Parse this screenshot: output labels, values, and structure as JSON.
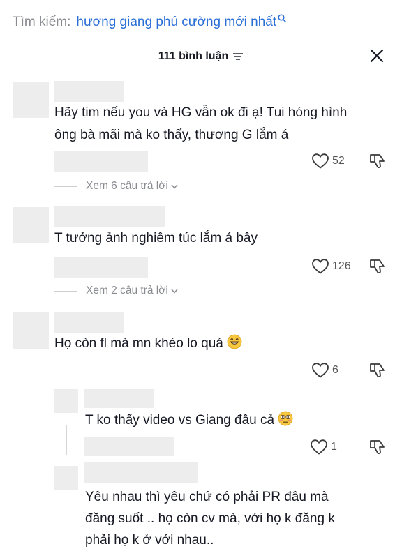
{
  "search": {
    "label": "Tìm kiếm:",
    "query": "hương giang phú cường mới nhất"
  },
  "sheet": {
    "comment_count": "111 bình luận"
  },
  "comments": [
    {
      "text_lines": [
        "Hãy tim nếu you và HG vẫn ok đi ạ! Tui hóng hình",
        "ông bà mãi mà ko thấy, thương G lắm á"
      ],
      "likes": "52",
      "replies": "Xem 6 câu trả lời"
    },
    {
      "text_lines": [
        "T tưởng ảnh nghiêm túc lắm á bây"
      ],
      "likes": "126",
      "replies": "Xem 2 câu trả lời"
    },
    {
      "text_lines": [
        "Họ còn fl mà mn khéo lo quá"
      ],
      "likes": "6",
      "emoji": "grinning-face-emoji"
    }
  ],
  "replies": [
    {
      "text_lines": [
        "T ko thấy video vs Giang đâu cả"
      ],
      "likes": "1",
      "emoji": "flushed-face-emoji"
    },
    {
      "text_lines": [
        "Yêu nhau thì yêu chứ có phải PR đâu mà",
        "đăng suốt .. họ còn cv mà, với họ k đăng k",
        "phải họ k ở với nhau.."
      ]
    }
  ],
  "colors": {
    "accent": "#2b6fd6",
    "placeholder": "#ededed",
    "muted": "#888a90"
  }
}
